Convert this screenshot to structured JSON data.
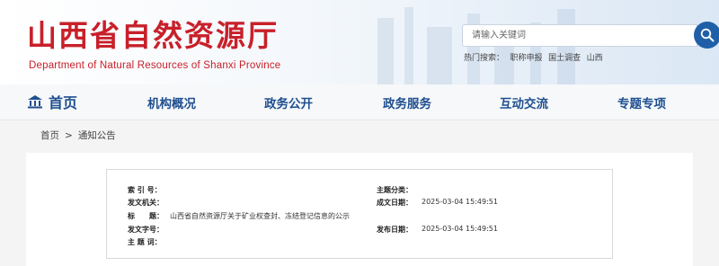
{
  "header": {
    "title": "山西省自然资源厅",
    "subtitle": "Department of Natural Resources of Shanxi Province",
    "search_placeholder": "请输入关键词",
    "hot_label": "热门搜索：",
    "hot_items": [
      "职称申报",
      "国土调查",
      "山西"
    ]
  },
  "nav": {
    "home": "首页",
    "items": [
      "机构概况",
      "政务公开",
      "政务服务",
      "互动交流",
      "专题专项"
    ]
  },
  "breadcrumb": {
    "home": "首页",
    "separator": ">",
    "current": "通知公告"
  },
  "meta": {
    "index_label": "索 引 号：",
    "index_value": "",
    "topic_label": "主题分类：",
    "topic_value": "",
    "issuer_label": "发文机关：",
    "issuer_value": "",
    "written_label": "成文日期：",
    "written_value": "2025-03-04 15:49:51",
    "title_label": "标　　题：",
    "title_value": "山西省自然资源厅关于矿业权查封、冻结登记信息的公示",
    "docno_label": "发文字号：",
    "docno_value": "",
    "publish_label": "发布日期：",
    "publish_value": "2025-03-04 15:49:51",
    "keywords_label": "主 题 词：",
    "keywords_value": ""
  },
  "colors": {
    "brand_red": "#c8202a",
    "nav_blue": "#1f4f8f",
    "search_button": "#1f5fa8"
  }
}
